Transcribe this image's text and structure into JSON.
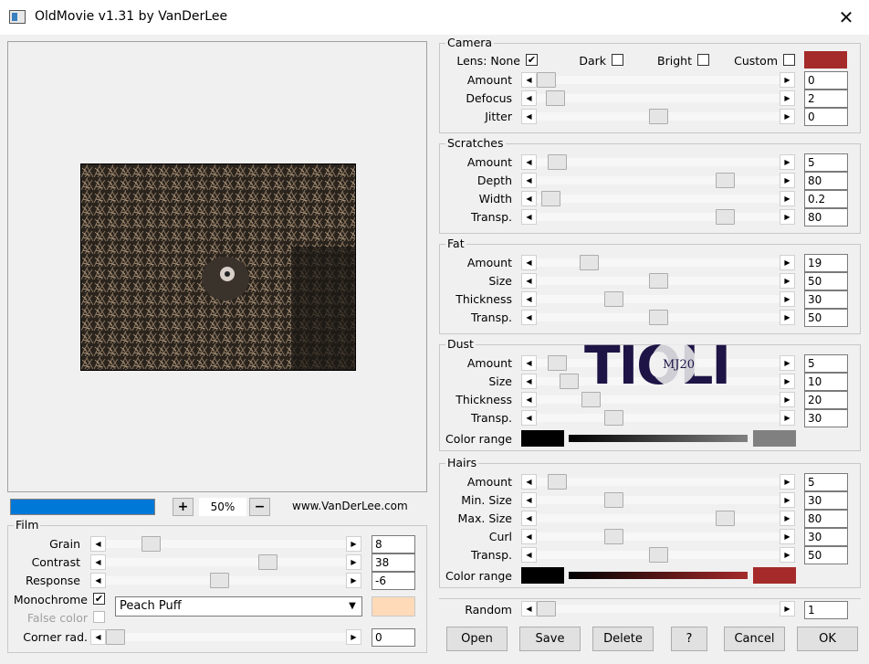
{
  "window": {
    "title": "OldMovie v1.31 by VanDerLee",
    "close_label": "✕"
  },
  "preview": {
    "zoom_out_label": "−",
    "zoom_in_label": "+",
    "zoom": "50%",
    "url": "www.VanDerLee.com",
    "progress_fraction": 1.0
  },
  "camera": {
    "title": "Camera",
    "lens_label": "Lens: None",
    "lens_checked": true,
    "dark_label": "Dark",
    "dark_checked": false,
    "bright_label": "Bright",
    "bright_checked": false,
    "custom_label": "Custom",
    "custom_checked": false,
    "color": "#a52a2a",
    "sliders": [
      {
        "label": "Amount",
        "value": "0",
        "fraction": 0.0
      },
      {
        "label": "Defocus",
        "value": "2",
        "fraction": 0.04
      },
      {
        "label": "Jitter",
        "value": "0",
        "fraction": 0.5
      }
    ]
  },
  "scratches": {
    "title": "Scratches",
    "sliders": [
      {
        "label": "Amount",
        "value": "5",
        "fraction": 0.05
      },
      {
        "label": "Depth",
        "value": "80",
        "fraction": 0.8
      },
      {
        "label": "Width",
        "value": "0.2",
        "fraction": 0.02
      },
      {
        "label": "Transp.",
        "value": "80",
        "fraction": 0.8
      }
    ]
  },
  "fat": {
    "title": "Fat",
    "sliders": [
      {
        "label": "Amount",
        "value": "19",
        "fraction": 0.19
      },
      {
        "label": "Size",
        "value": "50",
        "fraction": 0.5
      },
      {
        "label": "Thickness",
        "value": "30",
        "fraction": 0.3
      },
      {
        "label": "Transp.",
        "value": "50",
        "fraction": 0.5
      }
    ]
  },
  "dust": {
    "title": "Dust",
    "sliders": [
      {
        "label": "Amount",
        "value": "5",
        "fraction": 0.05
      },
      {
        "label": "Size",
        "value": "10",
        "fraction": 0.1
      },
      {
        "label": "Thickness",
        "value": "20",
        "fraction": 0.2
      },
      {
        "label": "Transp.",
        "value": "30",
        "fraction": 0.3
      }
    ],
    "color_range_label": "Color range",
    "color_from": "#000000",
    "color_to": "#808080"
  },
  "hairs": {
    "title": "Hairs",
    "sliders": [
      {
        "label": "Amount",
        "value": "5",
        "fraction": 0.05
      },
      {
        "label": "Min. Size",
        "value": "30",
        "fraction": 0.3
      },
      {
        "label": "Max. Size",
        "value": "80",
        "fraction": 0.8
      },
      {
        "label": "Curl",
        "value": "30",
        "fraction": 0.3
      },
      {
        "label": "Transp.",
        "value": "50",
        "fraction": 0.5
      }
    ],
    "color_range_label": "Color range",
    "color_from": "#000000",
    "color_to": "#a52a2a"
  },
  "random": {
    "label": "Random",
    "value": "1",
    "fraction": 0.0
  },
  "film": {
    "title": "Film",
    "sliders": [
      {
        "label": "Grain",
        "value": "8",
        "fraction": 0.16
      },
      {
        "label": "Contrast",
        "value": "38",
        "fraction": 0.69
      },
      {
        "label": "Response",
        "value": "-6",
        "fraction": 0.47
      }
    ],
    "monochrome_label": "Monochrome",
    "monochrome_checked": true,
    "false_color_label": "False color",
    "false_color_checked": false,
    "tint_name": "Peach Puff",
    "tint_color": "#ffdab9",
    "corner_label": "Corner rad.",
    "corner_value": "0",
    "corner_fraction": 0.0
  },
  "buttons": {
    "open": "Open",
    "save": "Save",
    "delete": "Delete",
    "help": "?",
    "cancel": "Cancel",
    "ok": "OK"
  },
  "watermark": {
    "text": "TIOLI",
    "badge": "MJ20"
  }
}
